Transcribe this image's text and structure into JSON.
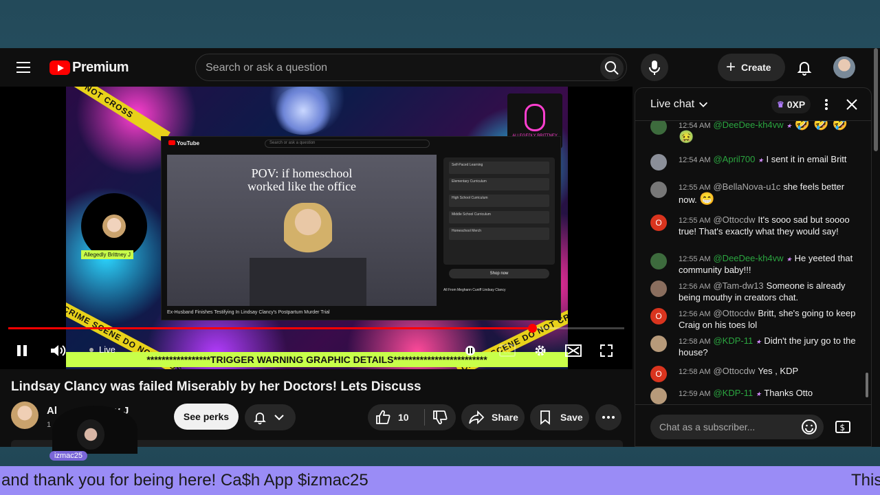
{
  "header": {
    "logo_text": "Premium",
    "search_placeholder": "Search or ask a question",
    "create_label": "Create"
  },
  "video_overlay": {
    "pov_line1": "POV: if homeschool",
    "pov_line2": "worked like the office",
    "trigger_banner": "*****************TRIGGER WARNING GRAPHIC DETAILS*************************",
    "host_tag": "Allegedly Brittney J",
    "inner_title": "Ex-Husband Finishes Testifying In Lindsay Clancy's Postpartum Murder Trial",
    "inner_sponsor": "Self-Paced Learning",
    "inner_shop": "Shop now",
    "inner_chips": "All    From Meghann Cuniff    Lindsay Clancy",
    "inner_rows": [
      "Elementary Curriculum",
      "High School Curriculum",
      "Middle School Curriculum",
      "Homeschool Merch"
    ]
  },
  "player": {
    "live_label": "Live",
    "progress_fraction": 0.85
  },
  "video": {
    "title": "Lindsay Clancy was failed Miserably by her Doctors! Lets Discuss",
    "channel_name": "Al",
    "channel_name_tail": "ttney J",
    "channel_sub": "1",
    "perks_label": "See perks",
    "like_count": "10",
    "share_label": "Share",
    "save_label": "Save"
  },
  "chat": {
    "title": "Live chat",
    "xp": "0XP",
    "input_placeholder": "Chat as a subscriber...",
    "messages": [
      {
        "time": "12:54 AM",
        "author": "@DeeDee-kh4vw",
        "text": "",
        "emoji": "🤣 🤣 🤣 🤢",
        "member": true,
        "avatar_color": "#3d6b3d",
        "initial": ""
      },
      {
        "time": "12:54 AM",
        "author": "@April700",
        "text": "I sent it in email Britt",
        "emoji": "",
        "member": true,
        "avatar_color": "#8b8f99",
        "initial": ""
      },
      {
        "time": "12:55 AM",
        "author": "@BellaNova-u1c",
        "text": "she feels better now.",
        "emoji": "😁",
        "member": false,
        "avatar_color": "#777777",
        "initial": ""
      },
      {
        "time": "12:55 AM",
        "author": "@Ottocdw",
        "text": "It's sooo sad but soooo true! That's exactly what they would say!",
        "emoji": "",
        "member": false,
        "avatar_color": "#d9341e",
        "initial": "O"
      },
      {
        "time": "12:55 AM",
        "author": "@DeeDee-kh4vw",
        "text": "He yeeted that community baby!!!",
        "emoji": "",
        "member": true,
        "avatar_color": "#3d6b3d",
        "initial": ""
      },
      {
        "time": "12:56 AM",
        "author": "@Tam-dw13",
        "text": "Someone is already being mouthy in creators chat.",
        "emoji": "",
        "member": false,
        "avatar_color": "#8a6e5e",
        "initial": ""
      },
      {
        "time": "12:56 AM",
        "author": "@Ottocdw",
        "text": "Britt, she's going to keep Craig on his toes lol",
        "emoji": "",
        "member": false,
        "avatar_color": "#d9341e",
        "initial": "O"
      },
      {
        "time": "12:58 AM",
        "author": "@KDP-11",
        "text": "Didn't the jury go to the house?",
        "emoji": "",
        "member": true,
        "avatar_color": "#b79a7a",
        "initial": ""
      },
      {
        "time": "12:58 AM",
        "author": "@Ottocdw",
        "text": "Yes , KDP",
        "emoji": "",
        "member": false,
        "avatar_color": "#d9341e",
        "initial": "O"
      },
      {
        "time": "12:59 AM",
        "author": "@KDP-11",
        "text": "Thanks Otto",
        "emoji": "",
        "member": true,
        "avatar_color": "#b79a7a",
        "initial": ""
      }
    ]
  },
  "stream_overlay": {
    "cam_name": "izmac25",
    "ticker_text": "and thank you for being here! Ca$h App $izmac25",
    "ticker_tail": "This"
  },
  "colors": {
    "accent_red": "#ff0000",
    "member_green": "#2ba640",
    "trigger_green": "#c8ff4a",
    "ticker_purple": "#9a8cf6"
  }
}
